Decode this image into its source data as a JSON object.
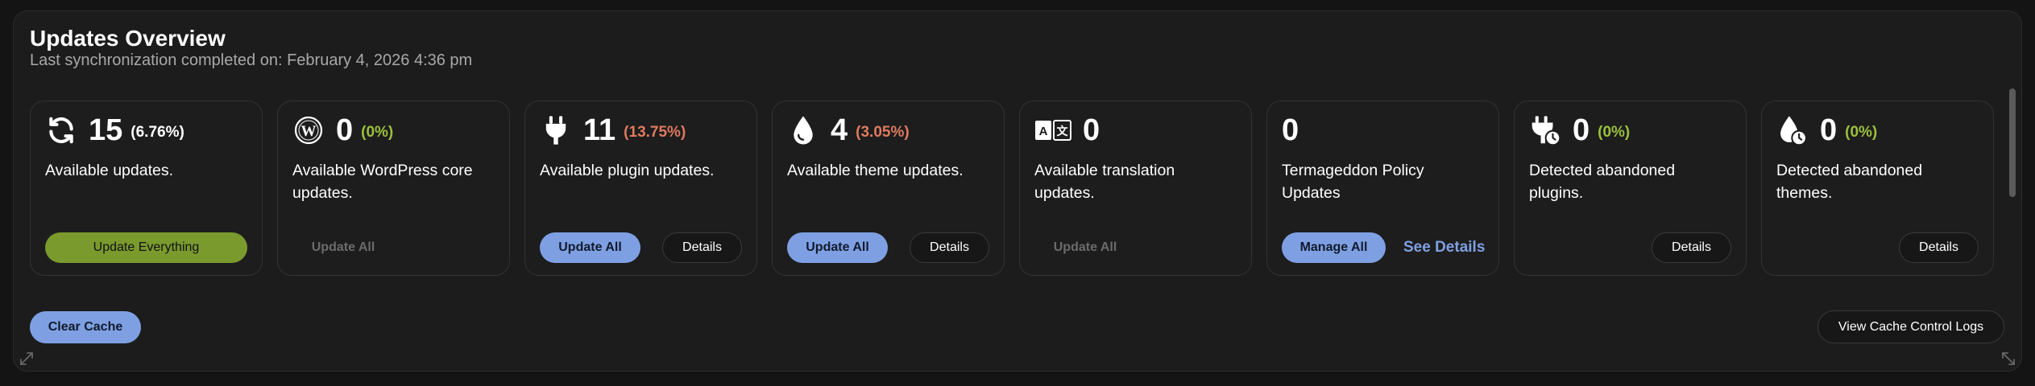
{
  "header": {
    "title": "Updates Overview",
    "subtitle": "Last synchronization completed on: February 4, 2026 4:36 pm"
  },
  "cards": [
    {
      "icon": "refresh-icon",
      "count": "15",
      "pct": "(6.76%)",
      "desc": "Available updates.",
      "primary": "Update Everything"
    },
    {
      "icon": "wordpress-icon",
      "count": "0",
      "pct": "(0%)",
      "desc": "Available WordPress core updates.",
      "primary": "Update All"
    },
    {
      "icon": "plug-icon",
      "count": "11",
      "pct": "(13.75%)",
      "desc": "Available plugin updates.",
      "primary": "Update All",
      "secondary": "Details"
    },
    {
      "icon": "drop-icon",
      "count": "4",
      "pct": "(3.05%)",
      "desc": "Available theme updates.",
      "primary": "Update All",
      "secondary": "Details"
    },
    {
      "icon": "translate-icon",
      "count": "0",
      "desc": "Available translation updates.",
      "primary": "Update All"
    },
    {
      "count": "0",
      "desc": "Termageddon Policy Updates",
      "primary": "Manage All",
      "secondary": "See Details"
    },
    {
      "icon": "plug-clock-icon",
      "count": "0",
      "pct": "(0%)",
      "desc": "Detected abandoned plugins.",
      "secondary": "Details"
    },
    {
      "icon": "drop-clock-icon",
      "count": "0",
      "pct": "(0%)",
      "desc": "Detected abandoned themes.",
      "secondary": "Details"
    }
  ],
  "footer": {
    "clear_cache": "Clear Cache",
    "view_logs": "View Cache Control Logs"
  },
  "colors": {
    "accent_blue": "#7ea0e3",
    "accent_green": "#7a9a2e",
    "positive": "#9bc13c",
    "negative": "#e07a5f"
  }
}
